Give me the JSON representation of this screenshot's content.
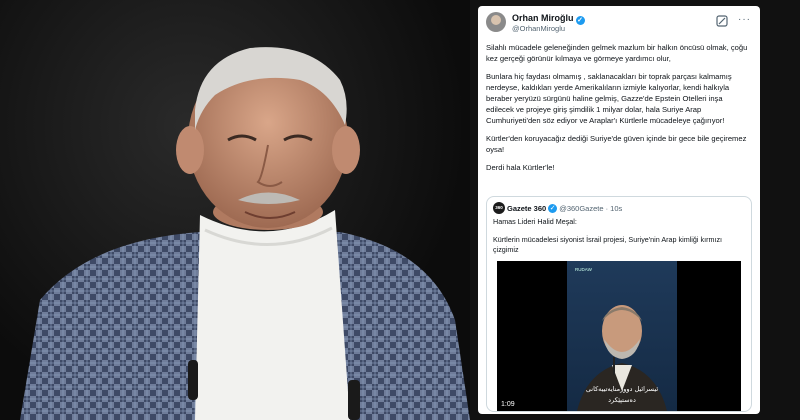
{
  "tweet": {
    "author_name": "Orhan Miroğlu",
    "author_handle": "@OrhanMiroglu",
    "icons": {
      "verified": "verified-badge-icon",
      "grok": "grok-icon",
      "more": "more-options-icon"
    },
    "more_glyph": "···",
    "paragraphs": [
      "Silahlı mücadele geleneğinden gelmek mazlum bir halkın öncüsü olmak, çoğu kez gerçeği görünür kılmaya ve görmeye yardımcı olur,",
      "Bunlara hiç faydası olmamış , saklanacakları bir toprak parçası kalmamış nerdeyse, kaldıkları yerde Amerikalıların izmiyle kalıyorlar, kendi halkıyla beraber yeryüzü sürgünü haline gelmiş, Gazze'de Epstein  Otelleri inşa edilecek ve projeye giriş şimdilik 1 milyar dolar, hala Suriye Arap Cumhuriyeti'den söz ediyor ve Araplar'ı Kürtlerle mücadeleye çağırıyor!",
      "Kürtler'den koruyacağız dediği Suriye'de güven içinde bir gece bile geçiremez oysa!",
      "Derdi hala Kürtler'le!"
    ],
    "quote": {
      "logo_text": "360",
      "name": "Gazete 360",
      "handle": "@360Gazete · 10s",
      "line1": "Hamas Lideri Halid Meşal:",
      "line2": "Kürtlerin mücadelesi siyonist İsrail projesi, Suriye'nin Arap kimliği kırmızı çizgimiz",
      "video": {
        "duration": "1:09",
        "caption_line1": "ئیسرائیل دووژمنایەتییەکانی",
        "caption_line2": "دەستپێکرد",
        "channel": "RUDAW"
      }
    }
  },
  "colors": {
    "verified": "#1d9bf0",
    "muted": "#536471",
    "border": "#cfd9de"
  }
}
